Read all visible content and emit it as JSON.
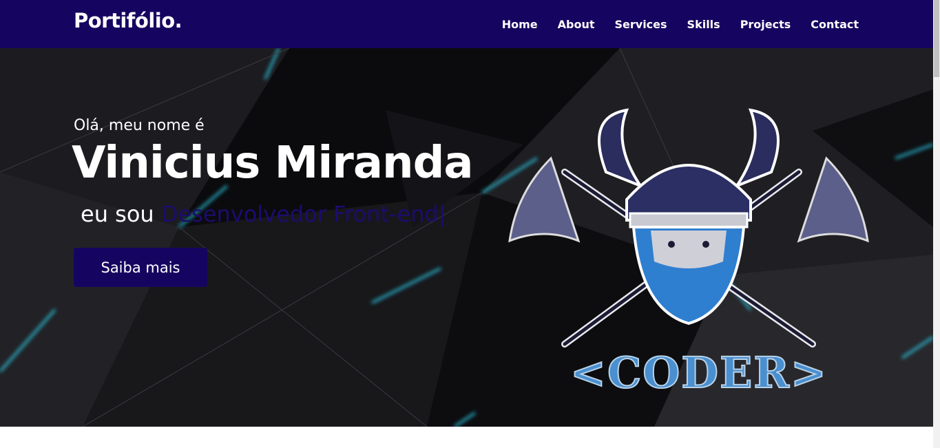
{
  "header": {
    "logo": "Portifólio.",
    "nav": [
      {
        "label": "Home"
      },
      {
        "label": "About"
      },
      {
        "label": "Services"
      },
      {
        "label": "Skills"
      },
      {
        "label": "Projects"
      },
      {
        "label": "Contact"
      }
    ]
  },
  "hero": {
    "greeting": "Olá, meu nome é",
    "name": "Vinicius Miranda",
    "role_prefix": "eu sou",
    "role_typed": "Desenvolvedor Front-end|",
    "cta_label": "Saiba mais",
    "emblem_text": "<CODER>"
  },
  "colors": {
    "nav_bg": "#160560",
    "accent": "#160560",
    "hero_bg": "#121214",
    "glow": "#2de0ff"
  }
}
